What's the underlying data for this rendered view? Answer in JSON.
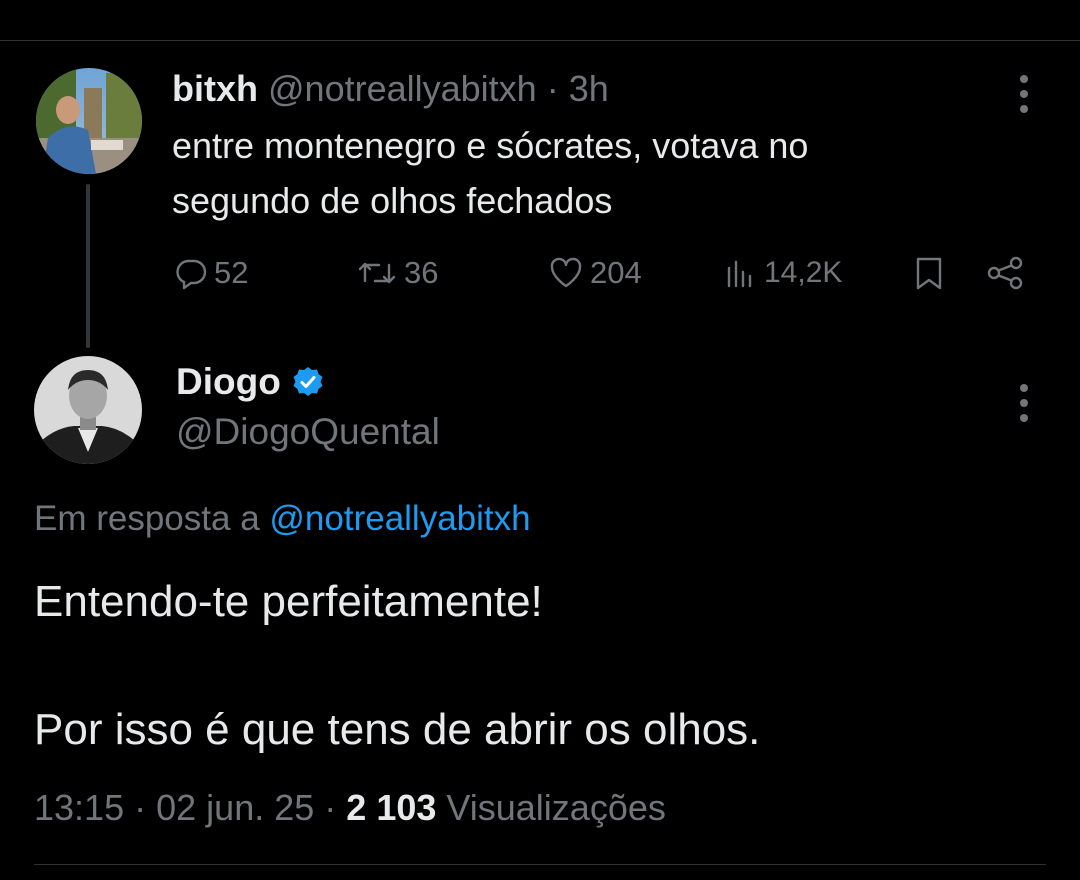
{
  "colors": {
    "background": "#000000",
    "text": "#e7e9ea",
    "muted": "#71767b",
    "link": "#1d9bf0",
    "verified": "#1d9bf0"
  },
  "parent_tweet": {
    "display_name": "bitxh",
    "handle": "@notreallyabitxh",
    "separator": "·",
    "time": "3h",
    "text_line1": "entre montenegro e sócrates, votava no",
    "text_line2": "segundo de olhos fechados",
    "actions": {
      "replies": "52",
      "retweets": "36",
      "likes": "204",
      "views": "14,2K"
    },
    "icons": [
      "reply-icon",
      "retweet-icon",
      "like-icon",
      "views-icon",
      "bookmark-icon",
      "share-icon",
      "more-icon"
    ]
  },
  "main_tweet": {
    "display_name": "Diogo",
    "verified": true,
    "handle": "@DiogoQuental",
    "reply_prefix": "Em resposta a",
    "reply_to": "@notreallyabitxh",
    "text_para1": "Entendo-te perfeitamente!",
    "text_para2": "Por isso é que tens de abrir os olhos.",
    "time": "13:15",
    "separator": "·",
    "date": "02 jun. 25",
    "views_count": "2 103",
    "views_label": "Visualizações"
  }
}
